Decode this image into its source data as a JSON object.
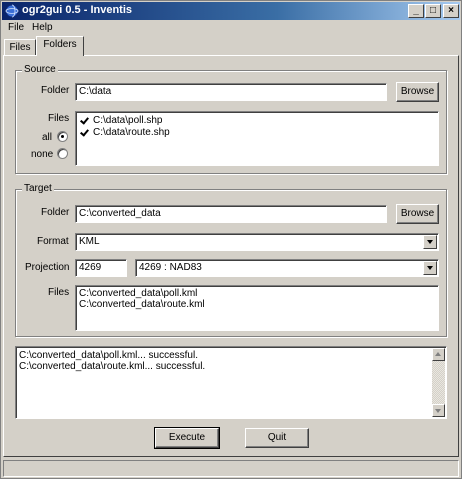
{
  "window": {
    "title": "ogr2gui 0.5 - Inventis",
    "controls": {
      "minimize": "_",
      "maximize": "□",
      "close": "×"
    }
  },
  "menu": {
    "items": [
      "File",
      "Help"
    ]
  },
  "tabs": [
    {
      "label": "Files",
      "active": false
    },
    {
      "label": "Folders",
      "active": true
    }
  ],
  "source": {
    "group_title": "Source",
    "folder_label": "Folder",
    "folder_value": "C:\\data",
    "browse_label": "Browse",
    "files_label": "Files",
    "files": [
      {
        "name": "C:\\data\\poll.shp",
        "checked": true
      },
      {
        "name": "C:\\data\\route.shp",
        "checked": true
      }
    ],
    "radio_all": "all",
    "radio_none": "none",
    "selected_radio": "all"
  },
  "target": {
    "group_title": "Target",
    "folder_label": "Folder",
    "folder_value": "C:\\converted_data",
    "browse_label": "Browse",
    "format_label": "Format",
    "format_value": "KML",
    "projection_label": "Projection",
    "projection_code": "4269",
    "projection_value": "4269 : NAD83",
    "files_label": "Files",
    "files": [
      "C:\\converted_data\\poll.kml",
      "C:\\converted_data\\route.kml"
    ]
  },
  "log": {
    "lines": [
      "C:\\converted_data\\poll.kml... successful.",
      "C:\\converted_data\\route.kml... successful."
    ]
  },
  "actions": {
    "execute_label": "Execute",
    "quit_label": "Quit"
  },
  "colors": {
    "titlebar_start": "#0a246a",
    "titlebar_end": "#a6caf0",
    "face": "#d4d0c8"
  },
  "icons": {
    "app": "globe-icon"
  }
}
